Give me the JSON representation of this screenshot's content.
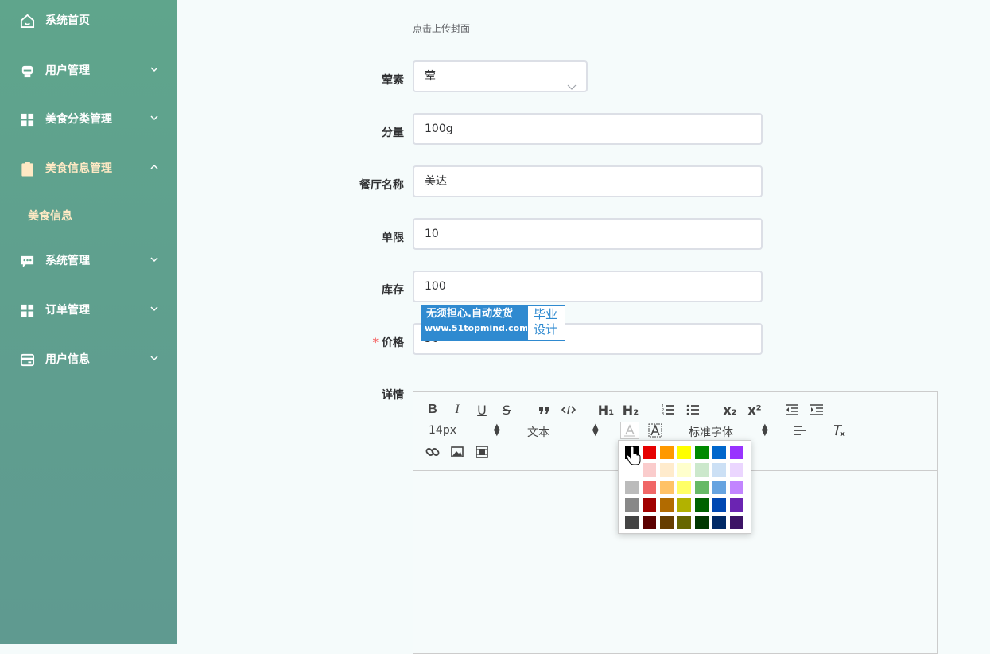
{
  "sidebar": {
    "items": [
      {
        "label": "系统首页",
        "icon": "home-icon"
      },
      {
        "label": "用户管理",
        "icon": "user-icon"
      },
      {
        "label": "美食分类管理",
        "icon": "grid-icon"
      },
      {
        "label": "美食信息管理",
        "icon": "clipboard-icon"
      },
      {
        "label": "系统管理",
        "icon": "chat-icon"
      },
      {
        "label": "订单管理",
        "icon": "grid-icon"
      },
      {
        "label": "用户信息",
        "icon": "card-icon"
      }
    ],
    "sub_item": {
      "label": "美食信息"
    }
  },
  "form": {
    "cover_hint": "点击上传封面",
    "fields": {
      "meat": {
        "label": "荤素",
        "value": "荤"
      },
      "portion": {
        "label": "分量",
        "value": "100g"
      },
      "restaurant": {
        "label": "餐厅名称",
        "value": "美达"
      },
      "limit": {
        "label": "单限",
        "value": "10"
      },
      "stock": {
        "label": "库存",
        "value": "100"
      },
      "price": {
        "label": "价格",
        "required_mark": "*",
        "value": "36"
      },
      "details": {
        "label": "详情"
      }
    }
  },
  "watermark": {
    "line1": "无须担心.自动发货",
    "line2": "www.51topmind.com",
    "right1": "毕业",
    "right2": "设计"
  },
  "editor": {
    "font_size": "14px",
    "header_select": "文本",
    "font_family": "标准字体",
    "placeholder": "",
    "toolbar_glyphs": {
      "bold": "B",
      "italic": "I",
      "underline": "U",
      "strike": "S",
      "h1": "H₁",
      "h2": "H₂",
      "sub": "x₂",
      "sup": "x²"
    }
  },
  "colors": {
    "accent": "#5fa58c",
    "active_menu_text": "#ffe9c4",
    "required": "#f56c6c",
    "palette": [
      [
        "#000000",
        "#e60000",
        "#ff9900",
        "#ffff00",
        "#008a00",
        "#0066cc",
        "#9933ff"
      ],
      [
        "#ffffff",
        "#facccc",
        "#ffebcc",
        "#ffffcc",
        "#cce8cc",
        "#cce0f5",
        "#ebd6ff"
      ],
      [
        "#bbbbbb",
        "#f06666",
        "#ffc266",
        "#ffff66",
        "#66b966",
        "#66a3e0",
        "#c285ff"
      ],
      [
        "#888888",
        "#a10000",
        "#b26b00",
        "#b2b200",
        "#006100",
        "#0047b2",
        "#6b24b2"
      ],
      [
        "#444444",
        "#5c0000",
        "#663d00",
        "#666600",
        "#003700",
        "#002966",
        "#3d1466"
      ]
    ]
  }
}
